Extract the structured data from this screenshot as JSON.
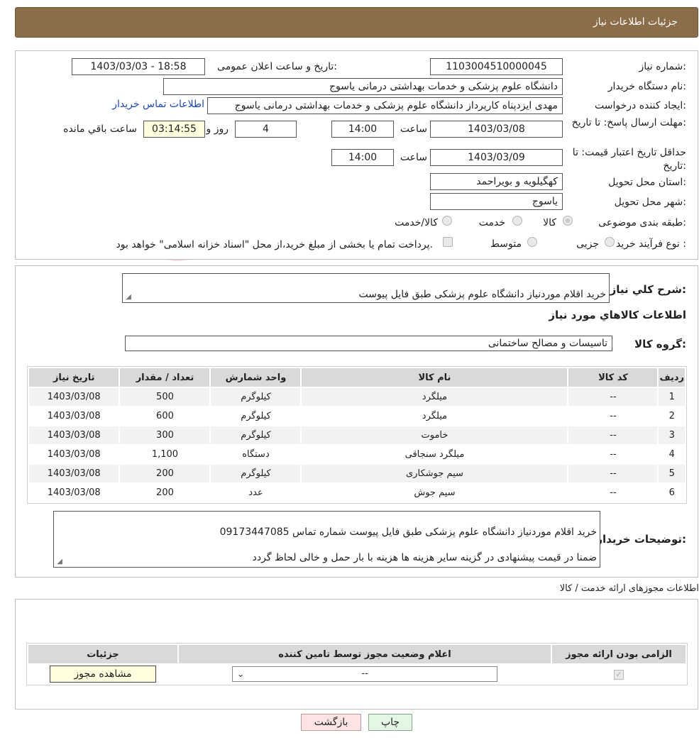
{
  "header": {
    "title": "جزئیات اطلاعات نیاز"
  },
  "details": {
    "need_number_label": "شماره نیاز:",
    "need_number": "1103004510000045",
    "announce_label": "تاریخ و ساعت اعلان عمومی:",
    "announce_value": "1403/03/03 - 18:58",
    "buyer_org_label": "نام دستگاه خریدار:",
    "buyer_org": "دانشگاه علوم پزشکی و خدمات بهداشتی  درمانی یاسوج",
    "requester_label": "ایجاد کننده درخواست:",
    "requester": "مهدی ایزدپناه کارپرداز دانشگاه علوم پزشکی و خدمات بهداشتی  درمانی یاسوج",
    "buyer_contact_link": "اطلاعات تماس خریدار",
    "deadline_label": "مهلت ارسال پاسخ: تا تاریخ:",
    "deadline_date": "1403/03/08",
    "time_label": "ساعت",
    "deadline_time": "14:00",
    "days_value": "4",
    "days_label": "روز و",
    "remaining_time": "03:14:55",
    "remaining_label": "ساعت باقي مانده",
    "validity_label": "حداقل تاریخ اعتبار قیمت: تا تاریخ:",
    "validity_date": "1403/03/09",
    "validity_time": "14:00",
    "province_label": "استان محل تحویل:",
    "province": "کهگیلویه و بویراحمد",
    "city_label": "شهر محل تحویل:",
    "city": "یاسوج",
    "category_label": "طبقه بندی موضوعی:",
    "category_options": [
      "کالا",
      "خدمت",
      "کالا/خدمت"
    ],
    "process_label": "نوع فرآیند خرید :",
    "process_options": [
      "جزیی",
      "متوسط"
    ],
    "process_note": "پرداخت تمام یا بخشی از مبلغ خرید،از محل \"اسناد خزانه اسلامی\" خواهد بود."
  },
  "summary": {
    "label": "شرح کلي نیاز:",
    "value": "خرید اقلام موردنیاز دانشگاه علوم پزشکی طبق فایل پیوست",
    "goods_info_title": "اطلاعات کالاهاي مورد نیاز",
    "goods_group_label": "گروه کالا:",
    "goods_group": "تاسیسات و مصالح ساختمانی"
  },
  "items_table": {
    "headers": [
      "ردیف",
      "کد کالا",
      "نام کالا",
      "واحد شمارش",
      "تعداد / مقدار",
      "تاریخ نیاز"
    ],
    "rows": [
      [
        "1",
        "--",
        "میلگرد",
        "کیلوگرم",
        "500",
        "1403/03/08"
      ],
      [
        "2",
        "--",
        "میلگرد",
        "کیلوگرم",
        "600",
        "1403/03/08"
      ],
      [
        "3",
        "--",
        "خاموت",
        "کیلوگرم",
        "300",
        "1403/03/08"
      ],
      [
        "4",
        "--",
        "میلگرد سنجاقی",
        "دستگاه",
        "1,100",
        "1403/03/08"
      ],
      [
        "5",
        "--",
        "سیم جوشکاری",
        "کیلوگرم",
        "200",
        "1403/03/08"
      ],
      [
        "6",
        "--",
        "سیم جوش",
        "عدد",
        "200",
        "1403/03/08"
      ]
    ]
  },
  "buyer_notes": {
    "label": "توضیحات خریدار:",
    "line1": "خرید اقلام موردنیاز دانشگاه علوم پزشکی طبق فایل پیوست شماره تماس 09173447085",
    "line2": "ضمنا در قیمت پیشنهادی در گزینه سایر هزینه ها هزینه با بار حمل و خالی لحاظ گردد"
  },
  "permits": {
    "section_title": "اطلاعات مجوزهای ارائه خدمت / کالا",
    "headers": [
      "الزامی بودن ارائه مجوز",
      "اعلام وضعیت مجوز توسط تامین کننده",
      "جزئیات"
    ],
    "status_value": "--",
    "view_button": "مشاهده مجوز"
  },
  "footer": {
    "print_button": "چاپ",
    "back_button": "بازگشت"
  },
  "watermark": {
    "text": "AriaTender.neT"
  },
  "colors": {
    "header_bg": "#8c6d4a",
    "link": "#1a47c8",
    "remaining_bg": "#ffffe0",
    "back_bg": "#fde4e4",
    "print_bg": "#e4f7e4"
  }
}
